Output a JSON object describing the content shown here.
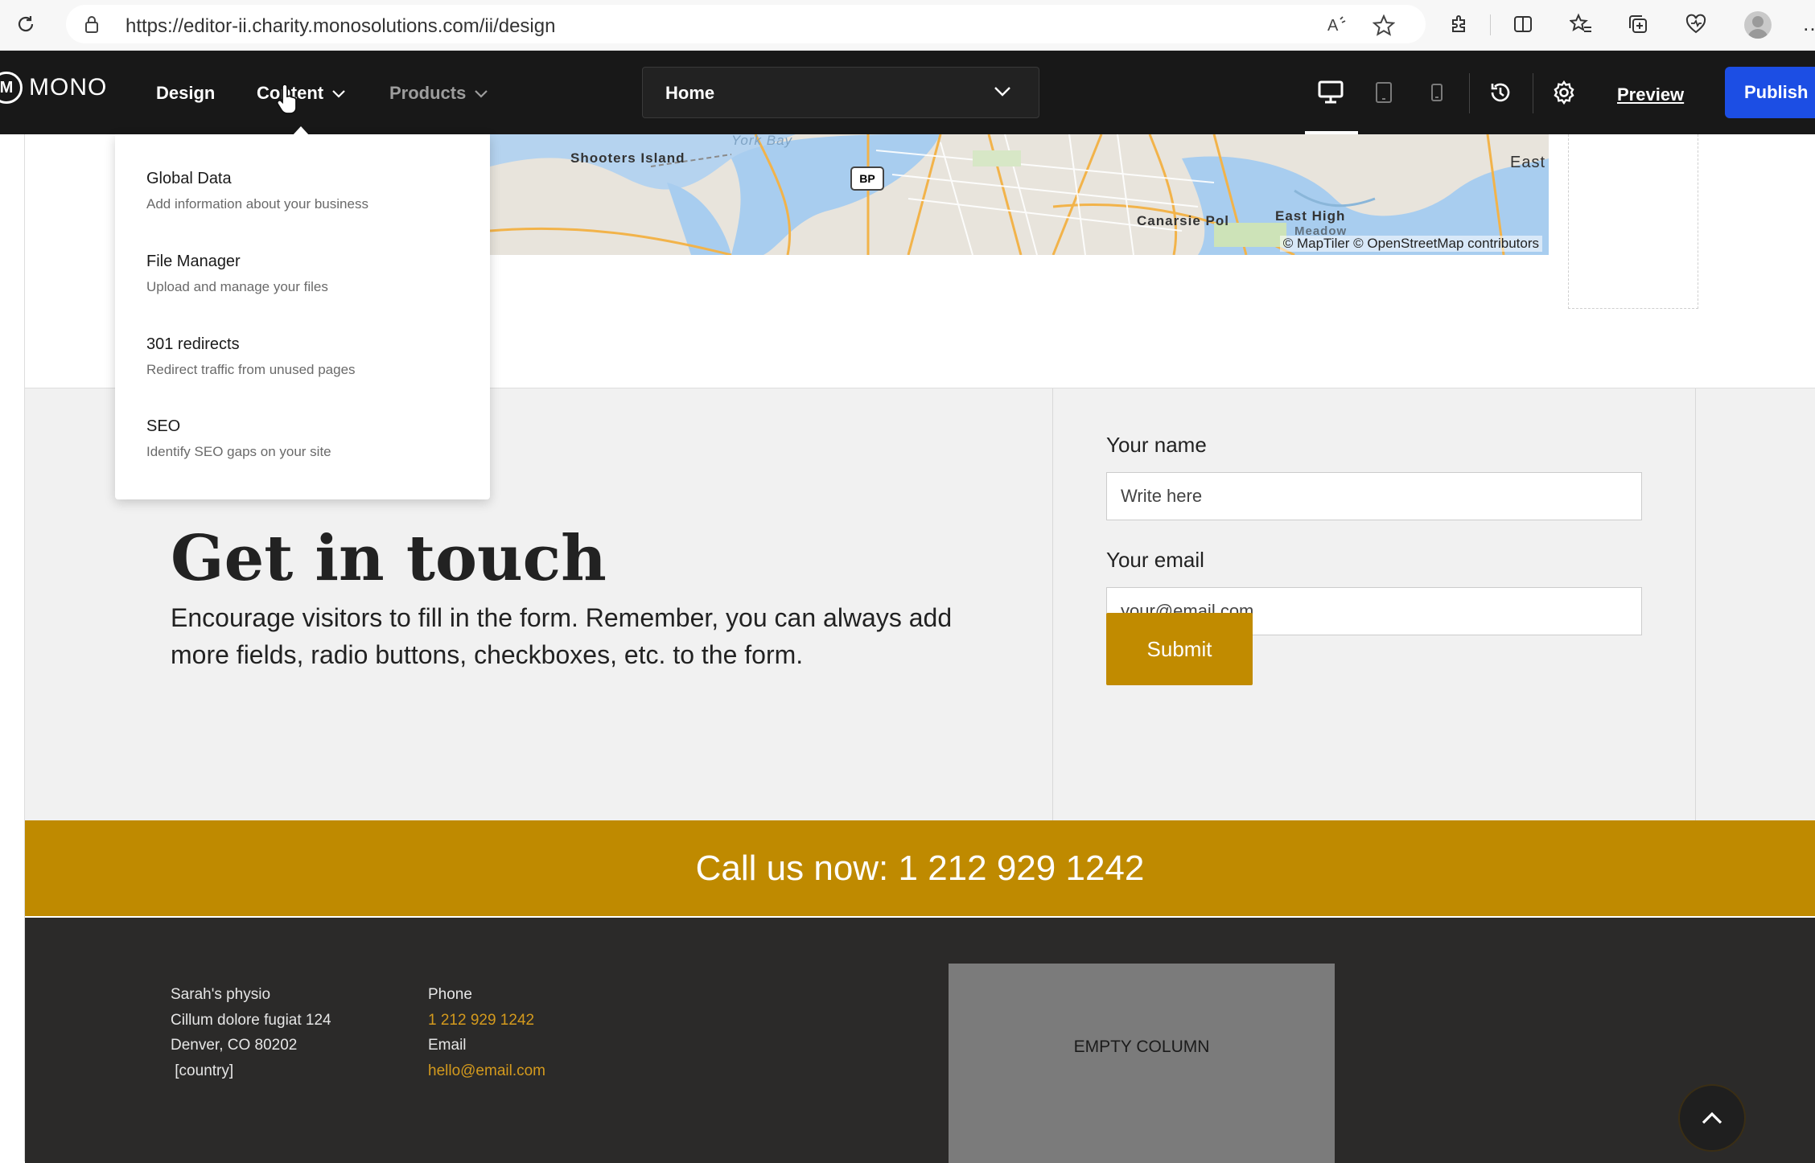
{
  "browser": {
    "url": "https://editor-ii.charity.monosolutions.com/ii/design",
    "icons": [
      "refresh-icon",
      "lock-icon",
      "read-aloud-icon",
      "favorite-star-icon",
      "extensions-icon",
      "split-screen-icon",
      "favorites-icon",
      "collections-icon",
      "browser-essentials-icon",
      "profile-avatar",
      "more-icon"
    ]
  },
  "toolbar": {
    "logo_letter": "M",
    "logo_text": "MONO",
    "nav": [
      "Design",
      "Content",
      "Products"
    ],
    "page_select": "Home",
    "preview": "Preview",
    "publish": "Publish",
    "icons": [
      "desktop-view-icon",
      "tablet-view-icon",
      "mobile-view-icon",
      "history-icon",
      "settings-icon"
    ]
  },
  "content_menu": {
    "items": [
      {
        "title": "Global Data",
        "subtitle": "Add information about your business"
      },
      {
        "title": "File Manager",
        "subtitle": "Upload and manage your files"
      },
      {
        "title": "301 redirects",
        "subtitle": "Redirect traffic from unused pages"
      },
      {
        "title": "SEO",
        "subtitle": "Identify SEO gaps on your site"
      }
    ]
  },
  "map": {
    "labels": [
      "Shooters Island",
      "York Bay",
      "BP",
      "East",
      "Canarsie Pol",
      "East High",
      "Meadow"
    ],
    "credit": "© MapTiler © OpenStreetMap contributors"
  },
  "contact": {
    "title": "Get in touch",
    "description": "Encourage visitors to fill in the form. Remember, you can always add more fields, radio buttons, checkboxes, etc. to the form.",
    "name_label": "Your name",
    "name_placeholder": "Write here",
    "email_label": "Your email",
    "email_placeholder": "your@email.com",
    "submit": "Submit"
  },
  "callbar": {
    "text": "Call us now: 1 212 929 1242"
  },
  "footer": {
    "address": [
      "Sarah's physio",
      "Cillum dolore fugiat 124",
      "Denver, CO 80202",
      " [country]"
    ],
    "phone_label": "Phone",
    "phone": "1 212 929 1242",
    "email_label": "Email",
    "email": "hello@email.com",
    "empty_column": "EMPTY COLUMN"
  },
  "colors": {
    "accent_gold": "#c18b00",
    "publish_blue": "#1c4ee4",
    "toolbar_bg": "#181818",
    "footer_bg": "#2b2a29"
  }
}
